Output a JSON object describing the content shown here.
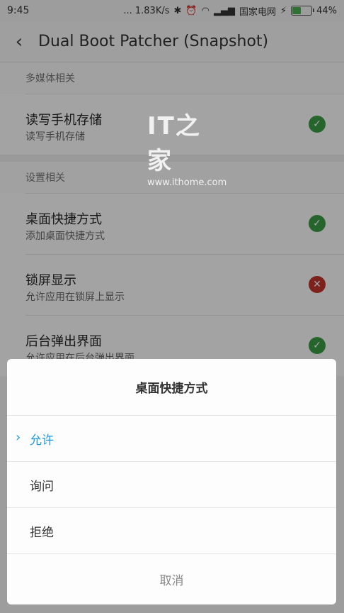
{
  "status_bar": {
    "time": "9:45",
    "net_speed": "... 1.83K/s",
    "carrier": "国家电网",
    "battery": "44%",
    "battery_level": 0.44
  },
  "app_bar": {
    "title": "Dual Boot Patcher (Snapshot)"
  },
  "watermark": {
    "logo": "IT之家",
    "url": "www.ithome.com"
  },
  "sections": [
    {
      "header": "多媒体相关",
      "items": [
        {
          "title": "读写手机存储",
          "subtitle": "读写手机存储",
          "status": "allowed"
        }
      ]
    },
    {
      "header": "设置相关",
      "items": [
        {
          "title": "桌面快捷方式",
          "subtitle": "添加桌面快捷方式",
          "status": "allowed"
        },
        {
          "title": "锁屏显示",
          "subtitle": "允许应用在锁屏上显示",
          "status": "denied"
        },
        {
          "title": "后台弹出界面",
          "subtitle": "允许应用在后台弹出界面",
          "status": "allowed"
        }
      ]
    }
  ],
  "dialog": {
    "title": "桌面快捷方式",
    "options": [
      "允许",
      "询问",
      "拒绝"
    ],
    "selected_index": 0,
    "cancel": "取消"
  },
  "colors": {
    "allowed": "#3a9a43",
    "denied": "#c0342b",
    "accent": "#1b98e0"
  }
}
